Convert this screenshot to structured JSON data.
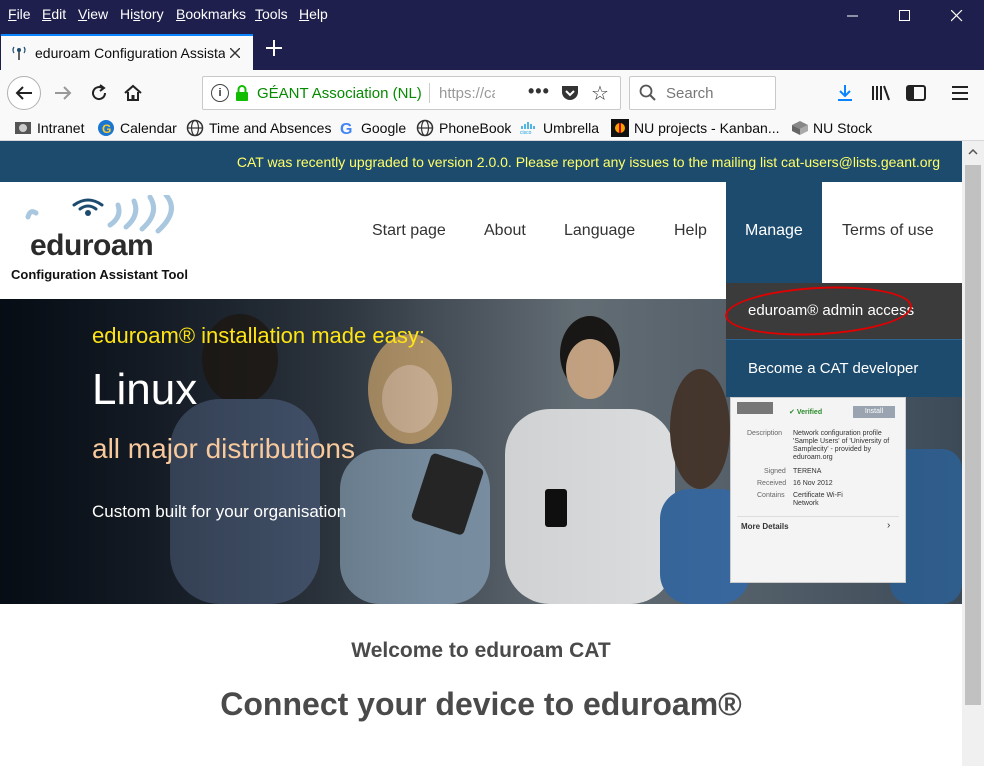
{
  "menubar": {
    "items": [
      {
        "pre": "",
        "u": "F",
        "post": "ile"
      },
      {
        "pre": "",
        "u": "E",
        "post": "dit"
      },
      {
        "pre": "",
        "u": "V",
        "post": "iew"
      },
      {
        "pre": "Hi",
        "u": "s",
        "post": "tory"
      },
      {
        "pre": "",
        "u": "B",
        "post": "ookmarks"
      },
      {
        "pre": "",
        "u": "T",
        "post": "ools"
      },
      {
        "pre": "",
        "u": "H",
        "post": "elp"
      }
    ],
    "minimize": "—",
    "maximize": "☐",
    "close": "✕"
  },
  "tab": {
    "title": "eduroam Configuration Assistant",
    "close": "✕",
    "new_tab": "+"
  },
  "navbar": {
    "back": "←",
    "forward": "→",
    "reload": "↻",
    "home": "⌂",
    "identity_org": "GÉANT Association (NL)",
    "url": "https://cat.eduroam.org",
    "page_actions": "•••",
    "bookmark_star": "☆",
    "search_placeholder": "Search",
    "download": "⤓",
    "library": "|||\\",
    "menu": "≡"
  },
  "bookmarks": [
    {
      "label": "Intranet",
      "icon": "intranet-icon"
    },
    {
      "label": "Calendar",
      "icon": "calendar-icon"
    },
    {
      "label": "Time and Absences",
      "icon": "globe-icon"
    },
    {
      "label": "Google",
      "icon": "google-icon"
    },
    {
      "label": "PhoneBook",
      "icon": "globe-icon"
    },
    {
      "label": "Umbrella",
      "icon": "cisco-icon"
    },
    {
      "label": "NU projects - Kanban...",
      "icon": "kanban-icon"
    },
    {
      "label": "NU Stock",
      "icon": "box-icon"
    }
  ],
  "page": {
    "notice": "CAT was recently upgraded to version 2.0.0. Please report any issues to the mailing list cat-users@lists.geant.org",
    "logo_text": "eduroam",
    "logo_subtitle": "Configuration Assistant Tool",
    "nav": [
      "Start page",
      "About",
      "Language",
      "Help",
      "Manage",
      "Terms of use"
    ],
    "manage_menu": [
      "eduroam® admin access",
      "Become a CAT developer"
    ],
    "hero": {
      "tagline": "eduroam® installation made easy:",
      "os": "Linux",
      "distributions": "all major distributions",
      "custom": "Custom built for your organisation"
    },
    "phone": {
      "verified": "Verified",
      "install": "Install",
      "description_label": "Description",
      "description": "Network configuration profile 'Sample Users' of 'University of Samplecity' - provided by eduroam.org",
      "signed_label": "Signed",
      "signed": "TERENA",
      "received_label": "Received",
      "received": "16 Nov 2012",
      "contains_label": "Contains",
      "contains": "Certificate Wi-Fi Network",
      "more": "More Details"
    },
    "welcome": "Welcome to eduroam CAT",
    "connect": "Connect your device to eduroam®"
  },
  "colors": {
    "chrome": "#1f1f4d",
    "cat_blue": "#1d4b6e",
    "notice_text": "#ffff66",
    "tagline": "#ffe414",
    "highlight_circle": "#e00000"
  }
}
